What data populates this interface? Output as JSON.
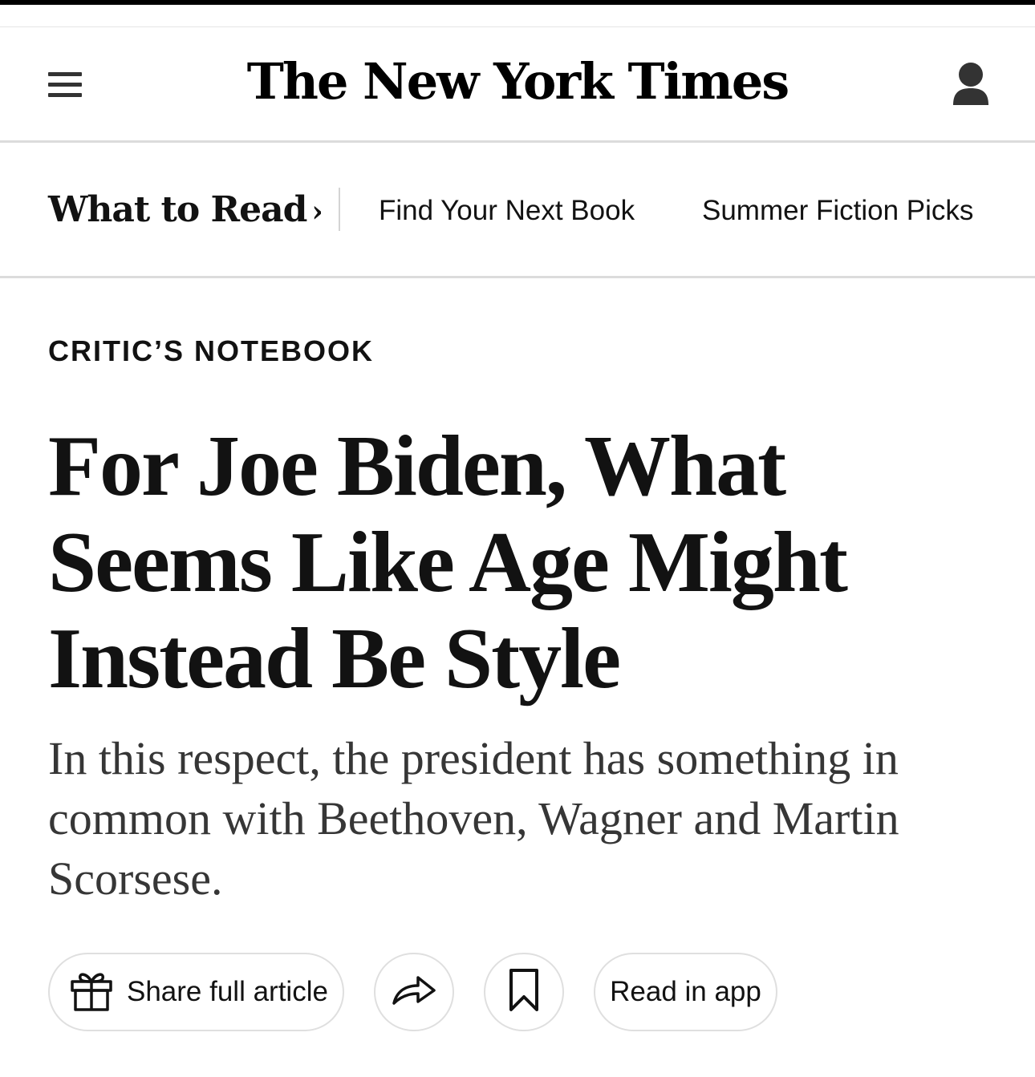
{
  "masthead": {
    "logo_text": "The New York Times",
    "menu_icon": "hamburger-menu-icon",
    "account_icon": "account-user-icon"
  },
  "subnav": {
    "section_title": "What to Read",
    "section_chevron": "›",
    "links": [
      "Find Your Next Book",
      "Summer Fiction Picks"
    ]
  },
  "article": {
    "kicker": "CRITIC’S NOTEBOOK",
    "headline": "For Joe Biden, What Seems Like Age Might Instead Be Style",
    "summary": "In this respect, the president has something in common with Beethoven, Wagner and Martin Scorsese."
  },
  "actions": {
    "share_label": "Share full article",
    "share_icon": "gift-icon",
    "forward_icon": "share-arrow-icon",
    "save_icon": "bookmark-icon",
    "app_label": "Read in app"
  }
}
